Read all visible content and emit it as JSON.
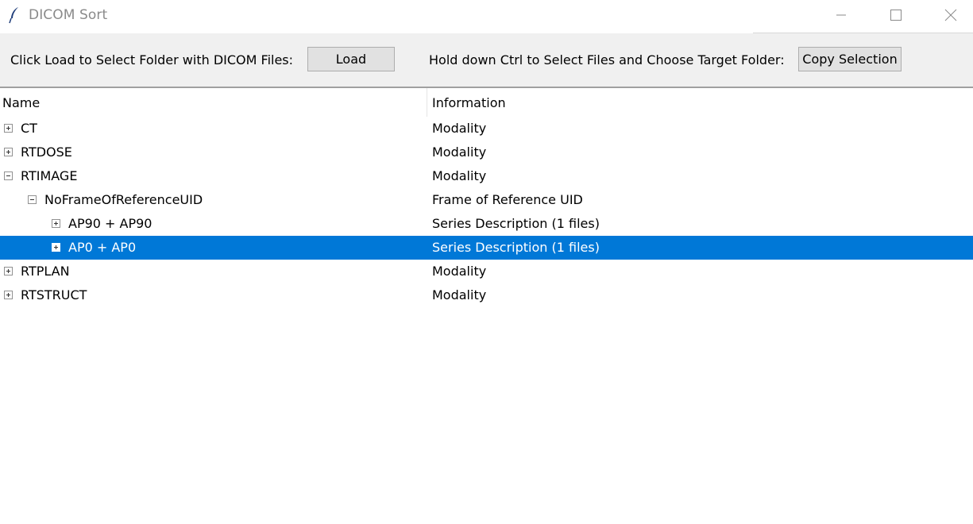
{
  "window": {
    "title": "DICOM Sort",
    "app_icon": "feather-icon",
    "controls": [
      "minimize-icon",
      "maximize-icon",
      "close-icon"
    ]
  },
  "toolbar": {
    "load_prompt": "Click Load to Select Folder with DICOM Files:",
    "load_label": "Load",
    "copy_prompt": "Hold down Ctrl to Select Files and Choose Target Folder:",
    "copy_label": "Copy Selection"
  },
  "tree": {
    "columns": {
      "name": "Name",
      "info": "Information"
    },
    "rows": [
      {
        "name": "CT",
        "info": "Modality",
        "level": 0,
        "expander": "plus",
        "selected": false
      },
      {
        "name": "RTDOSE",
        "info": "Modality",
        "level": 0,
        "expander": "plus",
        "selected": false
      },
      {
        "name": "RTIMAGE",
        "info": "Modality",
        "level": 0,
        "expander": "minus",
        "selected": false
      },
      {
        "name": "NoFrameOfReferenceUID",
        "info": "Frame of Reference UID",
        "level": 1,
        "expander": "minus",
        "selected": false
      },
      {
        "name": "AP90 + AP90",
        "info": "Series Description (1 files)",
        "level": 2,
        "expander": "plus",
        "selected": false
      },
      {
        "name": "AP0 + AP0",
        "info": "Series Description (1 files)",
        "level": 2,
        "expander": "plus",
        "selected": true
      },
      {
        "name": "RTPLAN",
        "info": "Modality",
        "level": 0,
        "expander": "plus",
        "selected": false
      },
      {
        "name": "RTSTRUCT",
        "info": "Modality",
        "level": 0,
        "expander": "plus",
        "selected": false
      }
    ]
  },
  "colors": {
    "selection": "#0078d7",
    "toolbar_bg": "#f0f0f0",
    "button_bg": "#e1e1e1"
  }
}
